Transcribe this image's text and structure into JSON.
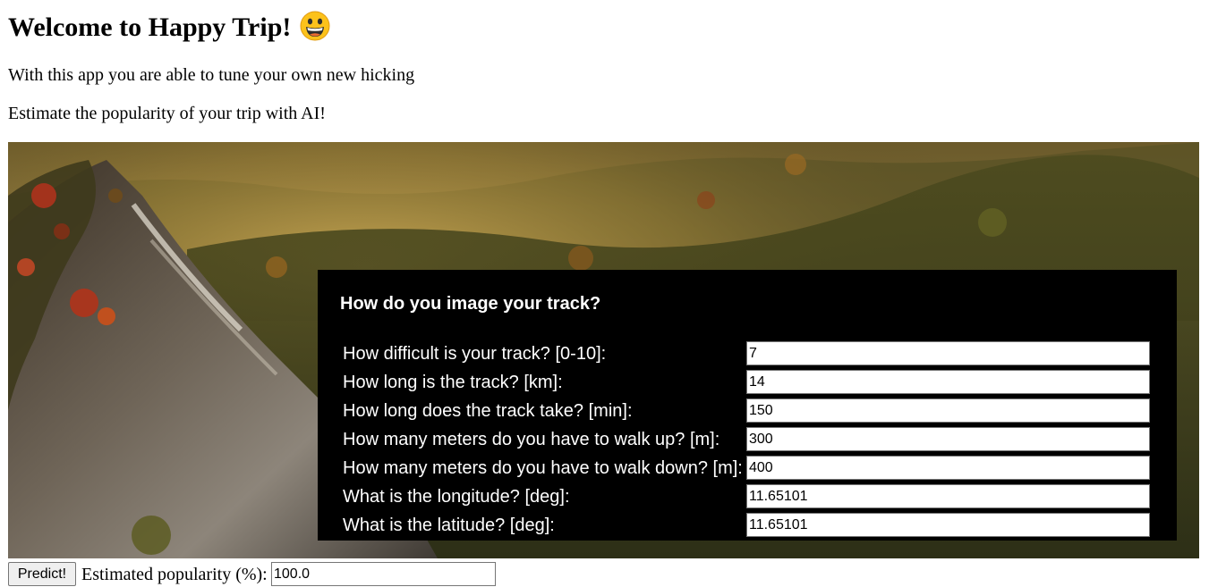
{
  "header": {
    "title": "Welcome to Happy Trip!",
    "emoji_icon": "grinning-face-emoji"
  },
  "intro": {
    "line1": "With this app you are able to tune your own new hicking",
    "line2": "Estimate the popularity of your trip with AI!"
  },
  "form": {
    "title": "How do you image your track?",
    "fields": [
      {
        "label": "How difficult is your track? [0-10]:",
        "value": "7"
      },
      {
        "label": "How long is the track? [km]:",
        "value": "14"
      },
      {
        "label": "How long does the track take? [min]:",
        "value": "150"
      },
      {
        "label": "How many meters do you have to walk up? [m]:",
        "value": "300"
      },
      {
        "label": "How many meters do you have to walk down? [m]:",
        "value": "400"
      },
      {
        "label": "What is the longitude? [deg]:",
        "value": "11.65101"
      },
      {
        "label": "What is the latitude? [deg]:",
        "value": "11.65101"
      }
    ]
  },
  "footer": {
    "predict_label": "Predict!",
    "result_label": "Estimated popularity (%):",
    "result_value": "100.0"
  },
  "colors": {
    "panel_bg": "#000000",
    "panel_text": "#ffffff"
  }
}
